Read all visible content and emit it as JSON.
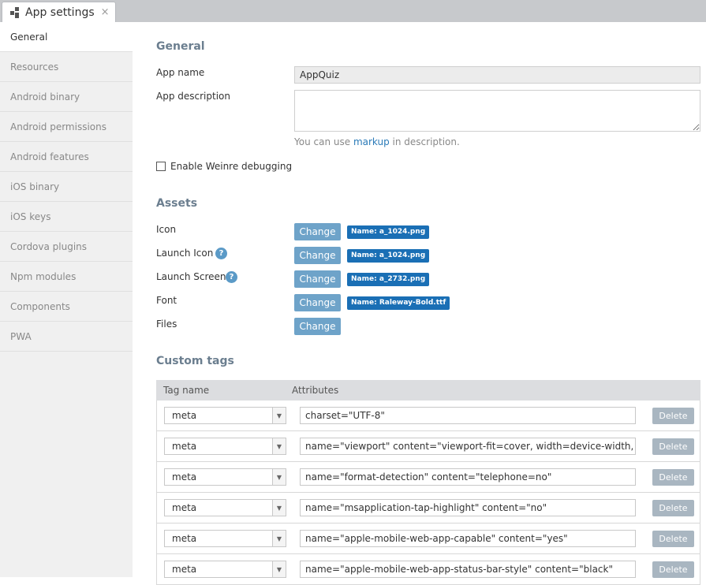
{
  "tab": {
    "title": "App settings",
    "close": "×",
    "icon": "app-settings-icon"
  },
  "sidebar": {
    "items": [
      {
        "label": "General",
        "active": true
      },
      {
        "label": "Resources"
      },
      {
        "label": "Android binary"
      },
      {
        "label": "Android permissions"
      },
      {
        "label": "Android features"
      },
      {
        "label": "iOS binary"
      },
      {
        "label": "iOS keys"
      },
      {
        "label": "Cordova plugins"
      },
      {
        "label": "Npm modules"
      },
      {
        "label": "Components"
      },
      {
        "label": "PWA"
      }
    ]
  },
  "general": {
    "title": "General",
    "app_name_label": "App name",
    "app_name_value": "AppQuiz",
    "app_description_label": "App description",
    "app_description_value": "",
    "hint_prefix": "You can use ",
    "hint_link": "markup",
    "hint_suffix": " in description.",
    "weinre_label": "Enable Weinre debugging",
    "weinre_checked": false
  },
  "assets": {
    "title": "Assets",
    "change_label": "Change",
    "items": [
      {
        "label": "Icon",
        "file": "Name: a_1024.png",
        "help": false
      },
      {
        "label": "Launch Icon",
        "file": "Name: a_1024.png",
        "help": true
      },
      {
        "label": "Launch Screen",
        "file": "Name: a_2732.png",
        "help": true
      },
      {
        "label": "Font",
        "file": "Name: Raleway-Bold.ttf",
        "help": false
      },
      {
        "label": "Files",
        "file": "",
        "help": false
      }
    ],
    "help_glyph": "?"
  },
  "custom_tags": {
    "title": "Custom tags",
    "col_tag": "Tag name",
    "col_attrs": "Attributes",
    "delete_label": "Delete",
    "rows": [
      {
        "tag": "meta",
        "attrs": "charset=\"UTF-8\""
      },
      {
        "tag": "meta",
        "attrs": "name=\"viewport\" content=\"viewport-fit=cover, width=device-width, initial-s"
      },
      {
        "tag": "meta",
        "attrs": "name=\"format-detection\" content=\"telephone=no\""
      },
      {
        "tag": "meta",
        "attrs": "name=\"msapplication-tap-highlight\" content=\"no\""
      },
      {
        "tag": "meta",
        "attrs": "name=\"apple-mobile-web-app-capable\" content=\"yes\""
      },
      {
        "tag": "meta",
        "attrs": "name=\"apple-mobile-web-app-status-bar-style\" content=\"black\""
      }
    ]
  },
  "colors": {
    "accent": "#6ea3c9",
    "badge": "#1a6fb5",
    "section_title": "#6b7e8f"
  }
}
